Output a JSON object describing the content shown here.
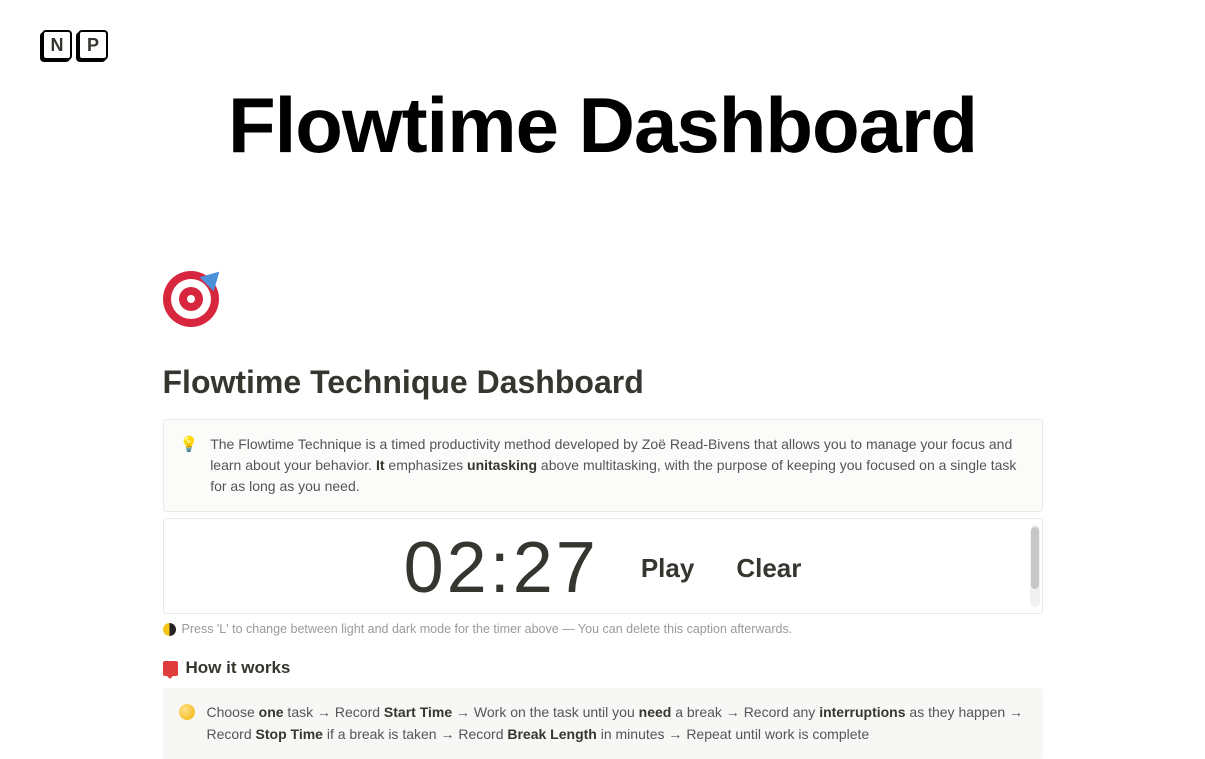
{
  "logo": {
    "letter1": "N",
    "letter2": "P"
  },
  "main_title": "Flowtime Dashboard",
  "page_heading": "Flowtime Technique Dashboard",
  "intro_callout": {
    "pre": "The Flowtime Technique is a timed productivity method developed by Zoë Read-Bivens that allows you to manage your focus and learn about your behavior. ",
    "bold1": "It",
    "mid": " emphasizes ",
    "bold2": "unitasking",
    "post": " above multitasking, with the purpose of keeping you focused on a single task for as long as you need."
  },
  "timer": {
    "display": "02:27",
    "play": "Play",
    "clear": "Clear"
  },
  "caption": "Press 'L' to change between light and dark mode for the timer above — You can delete this caption afterwards.",
  "how_it_works_heading": "How it works",
  "steps": {
    "s1a": "Choose ",
    "s1b": "one",
    "s2a": " task → Record ",
    "s2b": "Start Time",
    "s3a": " → Work on the task until you ",
    "s3b": "need",
    "s4a": " a break → Record any ",
    "s4b": "interruptions",
    "s5a": " as they happen → Record ",
    "s5b": "Stop Time",
    "s6a": " if a break is taken → Record ",
    "s6b": "Break Length",
    "s7": " in minutes → Repeat until work is complete"
  }
}
